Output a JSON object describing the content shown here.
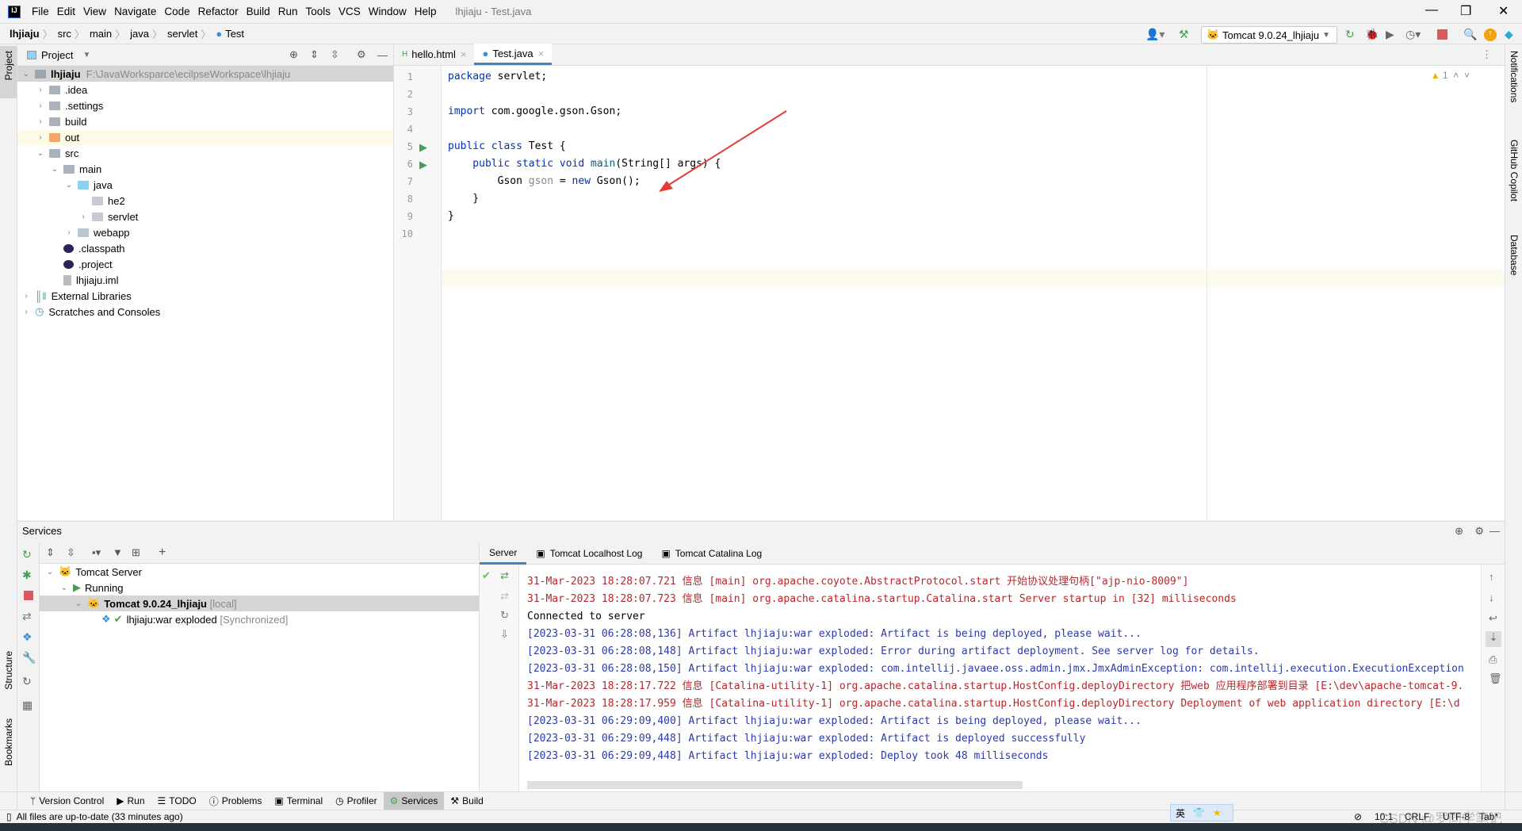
{
  "window": {
    "title": "lhjiaju - Test.java",
    "menu": [
      "File",
      "Edit",
      "View",
      "Navigate",
      "Code",
      "Refactor",
      "Build",
      "Run",
      "Tools",
      "VCS",
      "Window",
      "Help"
    ]
  },
  "breadcrumb": [
    "lhjiaju",
    "src",
    "main",
    "java",
    "servlet",
    "Test"
  ],
  "toolbar": {
    "run_config": "Tomcat 9.0.24_lhjiaju"
  },
  "left_strip": {
    "project": "Project",
    "structure": "Structure",
    "bookmarks": "Bookmarks"
  },
  "right_strip": {
    "notifications": "Notifications",
    "copilot": "GitHub Copilot",
    "database": "Database"
  },
  "project": {
    "title": "Project",
    "root_name": "lhjiaju",
    "root_path": "F:\\JavaWorksparce\\ecilpseWorkspace\\lhjiaju",
    "items": [
      ".idea",
      ".settings",
      "build",
      "out",
      "src",
      "main",
      "java",
      "he2",
      "servlet",
      "webapp",
      ".classpath",
      ".project",
      "lhjiaju.iml",
      "External Libraries",
      "Scratches and Consoles"
    ]
  },
  "editor": {
    "tabs": [
      "hello.html",
      "Test.java"
    ],
    "active_tab": "Test.java",
    "warnings": "1",
    "lines": [
      "1",
      "2",
      "3",
      "4",
      "5",
      "6",
      "7",
      "8",
      "9",
      "10"
    ]
  },
  "code": {
    "l1a": "package",
    "l1b": " servlet;",
    "l3a": "import",
    "l3b": " com.google.gson.Gson;",
    "l5a": "public class",
    "l5b": " Test {",
    "l6a": "    public static void ",
    "l6b": "main",
    "l6c": "(String[] args) {",
    "l7a": "        Gson ",
    "l7b": "gson",
    "l7c": " = ",
    "l7d": "new",
    "l7e": " Gson();",
    "l8": "    }",
    "l9": "}"
  },
  "services": {
    "title": "Services",
    "tree": {
      "server": "Tomcat Server",
      "running": "Running",
      "instance": "Tomcat 9.0.24_lhjiaju",
      "instance_tag": "[local]",
      "artifact": "lhjiaju:war exploded",
      "artifact_tag": "[Synchronized]"
    },
    "console_tabs": [
      "Server",
      "Tomcat Localhost Log",
      "Tomcat Catalina Log"
    ],
    "log": [
      {
        "t": "31-Mar-2023 18:28:07.721 信息 [main] org.apache.coyote.AbstractProtocol.start 开始协议处理句柄[\"ajp-nio-8009\"]",
        "c": "red"
      },
      {
        "t": "31-Mar-2023 18:28:07.723 信息 [main] org.apache.catalina.startup.Catalina.start Server startup in [32] milliseconds",
        "c": "red"
      },
      {
        "t": "Connected to server",
        "c": "black"
      },
      {
        "t": "[2023-03-31 06:28:08,136] Artifact lhjiaju:war exploded: Artifact is being deployed, please wait...",
        "c": "blue"
      },
      {
        "t": "[2023-03-31 06:28:08,148] Artifact lhjiaju:war exploded: Error during artifact deployment. See server log for details.",
        "c": "blue"
      },
      {
        "t": "[2023-03-31 06:28:08,150] Artifact lhjiaju:war exploded: com.intellij.javaee.oss.admin.jmx.JmxAdminException: com.intellij.execution.ExecutionException",
        "c": "blue"
      },
      {
        "t": "31-Mar-2023 18:28:17.722 信息 [Catalina-utility-1] org.apache.catalina.startup.HostConfig.deployDirectory 把web 应用程序部署到目录 [E:\\dev\\apache-tomcat-9.",
        "c": "red"
      },
      {
        "t": "31-Mar-2023 18:28:17.959 信息 [Catalina-utility-1] org.apache.catalina.startup.HostConfig.deployDirectory Deployment of web application directory [E:\\d",
        "c": "red"
      },
      {
        "t": "[2023-03-31 06:29:09,400] Artifact lhjiaju:war exploded: Artifact is being deployed, please wait...",
        "c": "blue"
      },
      {
        "t": "[2023-03-31 06:29:09,448] Artifact lhjiaju:war exploded: Artifact is deployed successfully",
        "c": "blue"
      },
      {
        "t": "[2023-03-31 06:29:09,448] Artifact lhjiaju:war exploded: Deploy took 48 milliseconds",
        "c": "blue"
      }
    ]
  },
  "bottom_tools": [
    "Version Control",
    "Run",
    "TODO",
    "Problems",
    "Terminal",
    "Profiler",
    "Services",
    "Build"
  ],
  "bottom_active": "Services",
  "status": {
    "message": "All files are up-to-date (33 minutes ago)",
    "position": "10:1",
    "line_sep": "CRLF",
    "encoding": "UTF-8",
    "indent": "Tab*",
    "ime": "英",
    "watermark": "CSDN @罗同学笔记"
  },
  "colors": {
    "accent": "#4083c9",
    "log_red": "#b7272b",
    "log_blue": "#2b3aa8",
    "keyword": "#0033b3",
    "stop": "#e05555",
    "run": "#499c54"
  }
}
